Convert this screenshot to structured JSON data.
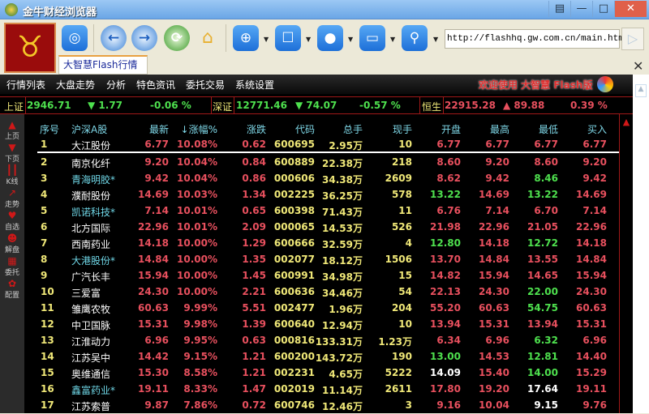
{
  "window": {
    "title": "金牛财经浏览器",
    "buttons": [
      "▤",
      "—",
      "□",
      "✕"
    ]
  },
  "toolbar": {
    "url": "http://flashhq.gw.com.cn/main.html"
  },
  "tab": {
    "label": "大智慧Flash行情",
    "close": "✕"
  },
  "menu": {
    "items": [
      "行情列表",
      "大盘走势",
      "分析",
      "特色资讯",
      "委托交易",
      "系统设置"
    ],
    "welcome": "欢迎使用 大智慧 Flash版"
  },
  "indices": [
    {
      "name": "上证",
      "value": "2946.71",
      "change": "▼ 1.77",
      "pct": "-0.06 %",
      "dir": "down"
    },
    {
      "name": "深证",
      "value": "12771.46",
      "change": "▼ 74.07",
      "pct": "-0.57 %",
      "dir": "down"
    },
    {
      "name": "恒生",
      "value": "22915.28",
      "change": "▲ 89.88",
      "pct": "0.39 %",
      "dir": "up"
    }
  ],
  "sidebar": [
    "上页",
    "下页",
    "K线",
    "走势",
    "自选",
    "解盘",
    "委托",
    "配置"
  ],
  "colors": {
    "up": "#e8505e",
    "down": "#4ee04e",
    "flat": "#ffffff",
    "yellow": "#f0e878",
    "cyan": "#70d8e8",
    "header": "#7fd8e8"
  },
  "table": {
    "headers": [
      "序号",
      "沪深A股",
      "最新",
      "↓涨幅%",
      "涨跌",
      "代码",
      "总手",
      "现手",
      "开盘",
      "最高",
      "最低",
      "买入"
    ],
    "rows": [
      [
        "1",
        "大江股份",
        "6.77",
        "10.08%",
        "0.62",
        "600695",
        "2.95万",
        "10",
        "6.77",
        "6.77",
        "6.77",
        "6.77"
      ],
      [
        "2",
        "南京化纤",
        "9.20",
        "10.04%",
        "0.84",
        "600889",
        "22.38万",
        "218",
        "8.60",
        "9.20",
        "8.60",
        "9.20"
      ],
      [
        "3",
        "青海明胶*",
        "9.42",
        "10.04%",
        "0.86",
        "000606",
        "34.38万",
        "2609",
        "8.62",
        "9.42",
        "8.46",
        "9.42"
      ],
      [
        "4",
        "濮耐股份",
        "14.69",
        "10.03%",
        "1.34",
        "002225",
        "36.25万",
        "578",
        "13.22",
        "14.69",
        "13.22",
        "14.69"
      ],
      [
        "5",
        "凯诺科技*",
        "7.14",
        "10.01%",
        "0.65",
        "600398",
        "71.43万",
        "11",
        "6.76",
        "7.14",
        "6.70",
        "7.14"
      ],
      [
        "6",
        "北方国际",
        "22.96",
        "10.01%",
        "2.09",
        "000065",
        "14.53万",
        "526",
        "21.98",
        "22.96",
        "21.05",
        "22.96"
      ],
      [
        "7",
        "西南药业",
        "14.18",
        "10.00%",
        "1.29",
        "600666",
        "32.59万",
        "4",
        "12.80",
        "14.18",
        "12.72",
        "14.18"
      ],
      [
        "8",
        "大港股份*",
        "14.84",
        "10.00%",
        "1.35",
        "002077",
        "18.12万",
        "1506",
        "13.70",
        "14.84",
        "13.55",
        "14.84"
      ],
      [
        "9",
        "广汽长丰",
        "15.94",
        "10.00%",
        "1.45",
        "600991",
        "34.98万",
        "15",
        "14.82",
        "15.94",
        "14.65",
        "15.94"
      ],
      [
        "10",
        "三爱富",
        "24.30",
        "10.00%",
        "2.21",
        "600636",
        "34.46万",
        "54",
        "22.13",
        "24.30",
        "22.00",
        "24.30"
      ],
      [
        "11",
        "雏鹰农牧",
        "60.63",
        "9.99%",
        "5.51",
        "002477",
        "1.96万",
        "204",
        "55.20",
        "60.63",
        "54.75",
        "60.63"
      ],
      [
        "12",
        "中卫国脉",
        "15.31",
        "9.98%",
        "1.39",
        "600640",
        "12.94万",
        "10",
        "13.94",
        "15.31",
        "13.94",
        "15.31"
      ],
      [
        "13",
        "江淮动力",
        "6.96",
        "9.95%",
        "0.63",
        "000816",
        "133.31万",
        "1.23万",
        "6.34",
        "6.96",
        "6.32",
        "6.96"
      ],
      [
        "14",
        "江苏吴中",
        "14.42",
        "9.15%",
        "1.21",
        "600200",
        "143.72万",
        "190",
        "13.00",
        "14.53",
        "12.81",
        "14.40"
      ],
      [
        "15",
        "奥维通信",
        "15.30",
        "8.58%",
        "1.21",
        "002231",
        "4.65万",
        "5222",
        "14.09",
        "15.40",
        "14.00",
        "15.29"
      ],
      [
        "16",
        "鑫富药业*",
        "19.11",
        "8.33%",
        "1.47",
        "002019",
        "11.14万",
        "2611",
        "17.80",
        "19.20",
        "17.64",
        "19.11"
      ],
      [
        "17",
        "江苏索普",
        "9.87",
        "7.86%",
        "0.72",
        "600746",
        "12.46万",
        "3",
        "9.16",
        "10.04",
        "9.15",
        "9.76"
      ]
    ]
  }
}
